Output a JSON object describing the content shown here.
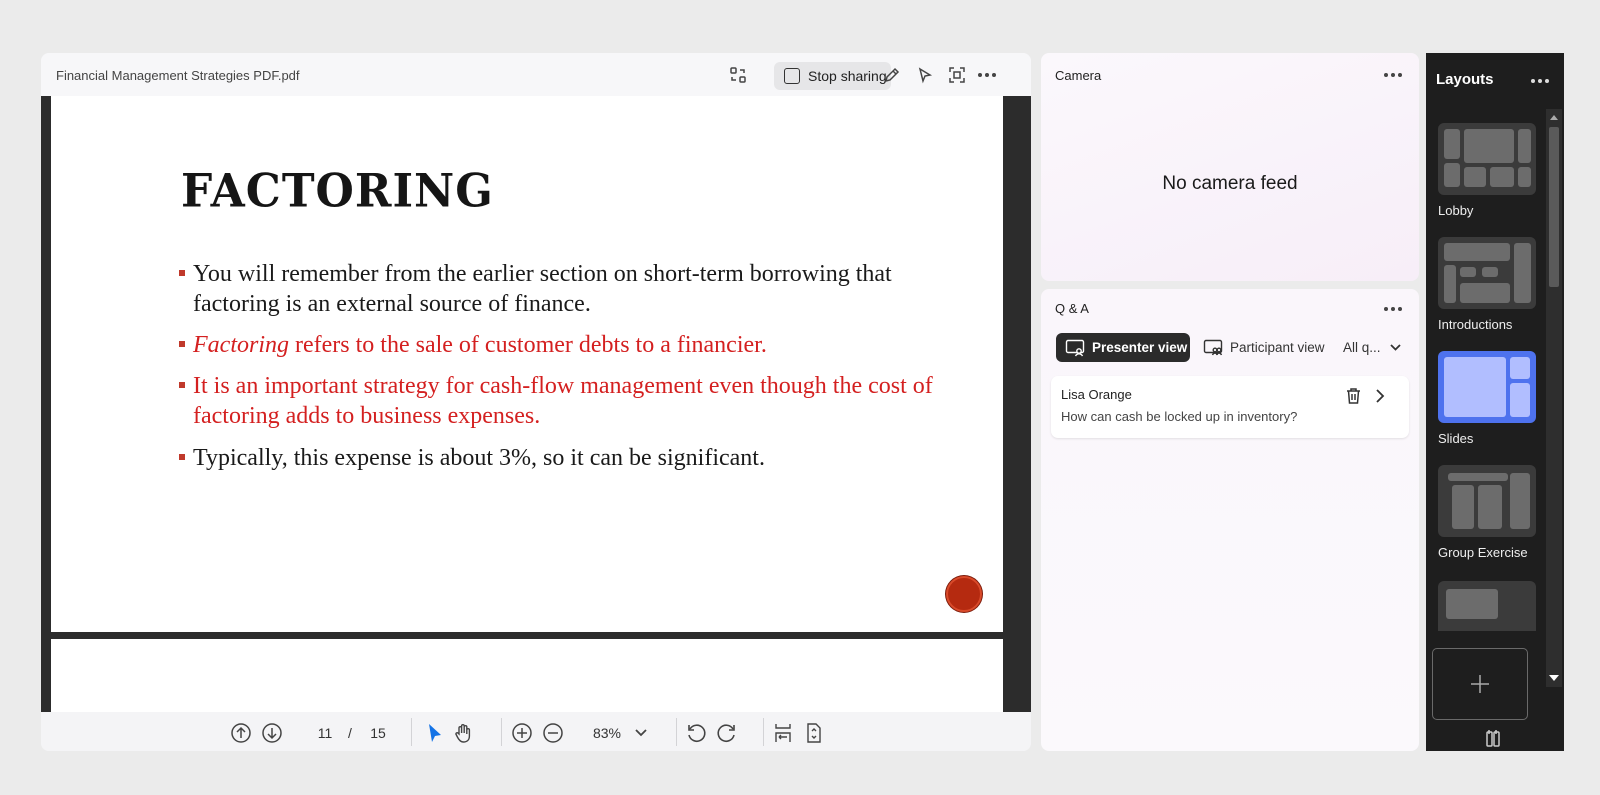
{
  "pdf_pod": {
    "file_name": "Financial Management Strategies PDF.pdf",
    "stop_sharing_label": "Stop sharing",
    "slide": {
      "title": "FACTORING",
      "bullets": [
        {
          "text": "You will remember from the earlier section on short-term borrowing that factoring is an external source of finance.",
          "color": "#1a1a1a"
        },
        {
          "lead_italic": "Factoring",
          "text": " refers to the sale of customer debts to a financier.",
          "color": "#d42020"
        },
        {
          "text": "It is an important strategy for cash-flow management even though the cost of factoring adds to business expenses.",
          "color": "#d42020"
        },
        {
          "text": "Typically, this expense is about 3%, so it can be significant.",
          "color": "#1a1a1a"
        }
      ]
    },
    "toolbar": {
      "current_page": "11",
      "page_separator": "/",
      "total_pages": "15",
      "zoom": "83%"
    }
  },
  "camera_pod": {
    "title": "Camera",
    "status": "No camera feed"
  },
  "qa_pod": {
    "title": "Q & A",
    "presenter_view_label": "Presenter view",
    "participant_view_label": "Participant view",
    "filter_label": "All q...",
    "questions": [
      {
        "author": "Lisa Orange",
        "text": "How  can cash be locked up in inventory?"
      }
    ]
  },
  "layouts_panel": {
    "title": "Layouts",
    "items": [
      {
        "label": "Lobby",
        "selected": false
      },
      {
        "label": "Introductions",
        "selected": false
      },
      {
        "label": "Slides",
        "selected": true
      },
      {
        "label": "Group Exercise",
        "selected": false
      }
    ]
  },
  "colors": {
    "accent_blue": "#4e72ee",
    "slide_red": "#d42020",
    "dark_panel": "#1e1e1e"
  }
}
